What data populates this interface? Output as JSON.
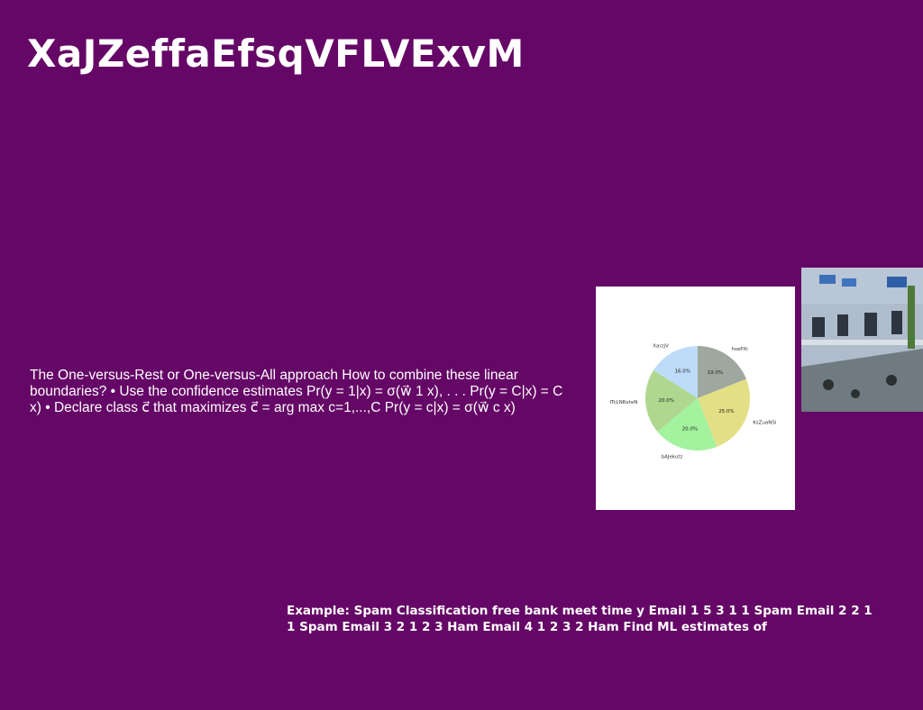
{
  "slide": {
    "title": "XaJZeffaEfsqVFLVExvM",
    "body": "The One-versus-Rest or One-versus-All approach How to combine these linear boundaries? • Use the confidence estimates Pr(y = 1|x) = σ(w⃗ 1 x), . . . Pr(y = C|x) = C x) • Declare class c⃗ that maximizes c⃗ = arg max c=1,...,C Pr(y = c|x) = σ(w⃗ c x)",
    "example": "Example: Spam Classification free bank meet time y Email 1 5 3 1 1 Spam Email 2 2 1 1 Spam Email 3 2 1 2 3 Ham Email 4 1 2 3 2 Ham Find ML estimates of"
  },
  "chart_data": {
    "type": "pie",
    "title": "",
    "slices": [
      {
        "label": "hsePXi",
        "value": 19.0,
        "pct_label": "19.0%",
        "color": "#9fa89f"
      },
      {
        "label": "KsZuaNSi",
        "value": 25.0,
        "pct_label": "25.0%",
        "color": "#e3df85"
      },
      {
        "label": "bAJekutz",
        "value": 20.0,
        "pct_label": "20.0%",
        "color": "#a2f29e"
      },
      {
        "label": "ITcLNRxteN",
        "value": 20.0,
        "pct_label": "20.0%",
        "color": "#afd78f"
      },
      {
        "label": "XarzjV",
        "value": 16.0,
        "pct_label": "16.0%",
        "color": "#bcdcfa"
      }
    ],
    "start_angle": "top",
    "direction": "clockwise"
  },
  "photo": {
    "icon": "building-photo"
  }
}
